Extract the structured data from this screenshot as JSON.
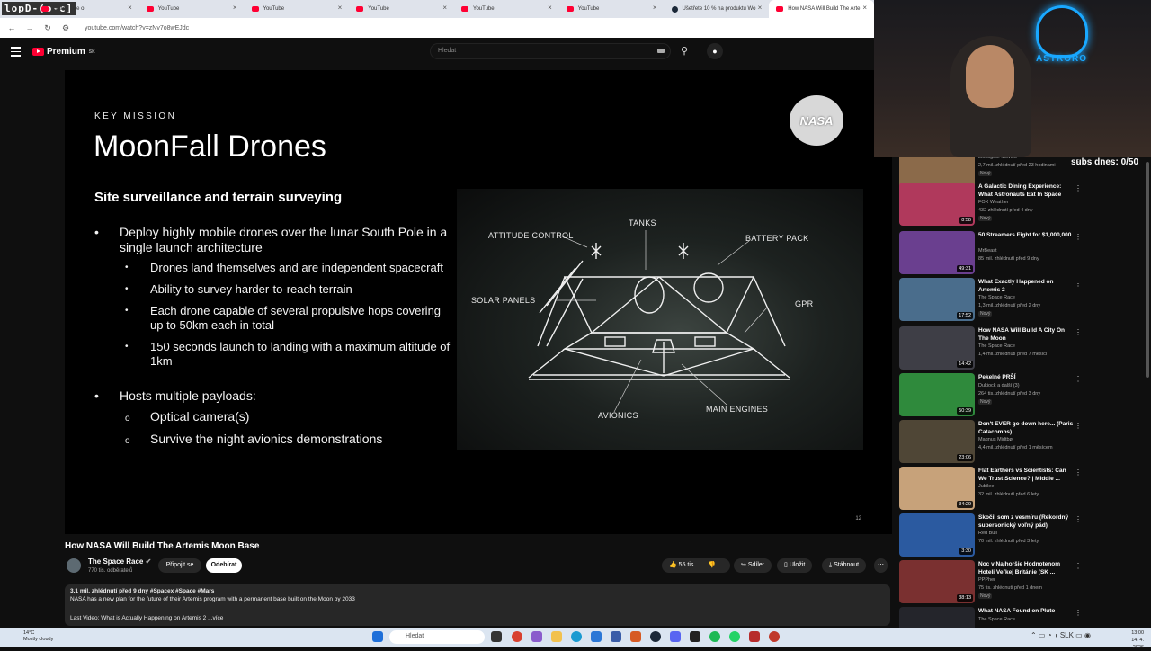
{
  "browser": {
    "stream_logo": "lopD-(o-c]",
    "tabs": [
      {
        "title": "Watch Live o",
        "icon": "youtube-icon"
      },
      {
        "title": "YouTube",
        "icon": "youtube-icon"
      },
      {
        "title": "YouTube",
        "icon": "youtube-icon"
      },
      {
        "title": "YouTube",
        "icon": "youtube-icon"
      },
      {
        "title": "YouTube",
        "icon": "youtube-icon"
      },
      {
        "title": "YouTube",
        "icon": "youtube-icon"
      },
      {
        "title": "Ušetřete 10 % na produktu Wo",
        "icon": "steam-icon"
      },
      {
        "title": "How NASA Will Build The Arte",
        "icon": "youtube-icon",
        "active": true
      }
    ],
    "url": "youtube.com/watch?v=zNv7o8wEJdc"
  },
  "youtube": {
    "logo_text": "Premium",
    "logo_sup": "SK",
    "search_placeholder": "Hledat"
  },
  "slide": {
    "kicker": "KEY MISSION",
    "title": "MoonFall Drones",
    "subtitle": "Site surveillance and terrain surveying",
    "b1_text": "Deploy highly mobile drones over the lunar South Pole in a single launch architecture",
    "b1_subs": [
      "Drones land themselves and are independent spacecraft",
      "Ability to survey harder-to-reach terrain",
      "Each drone capable of several propulsive hops covering up to 50km each in total",
      "150 seconds launch to landing with a maximum altitude of 1km"
    ],
    "b2_text": "Hosts multiple payloads:",
    "b2_subs": [
      "Optical camera(s)",
      "Survive the night avionics demonstrations"
    ],
    "nasa_logo": "NASA",
    "diagram_labels": {
      "tanks": "TANKS",
      "attitude": "ATTITUDE CONTROL",
      "battery": "BATTERY PACK",
      "solar": "SOLAR PANELS",
      "gpr": "GPR",
      "avionics": "AVIONICS",
      "engines": "MAIN ENGINES"
    },
    "slide_number": "12"
  },
  "video": {
    "title": "How NASA Will Build The Artemis Moon Base",
    "channel": "The Space Race",
    "subs": "770 tis. odběratelů",
    "join": "Připojit se",
    "subscribe": "Odebírat",
    "likes": "55 tis.",
    "share": "Sdílet",
    "save": "Uložit",
    "download": "Stáhnout",
    "desc_meta": "3,1 mil. zhlédnutí  před 9 dny  #Spacex #Space #Mars",
    "desc_line": "NASA has a new plan for the future of their Artemis program with a permanent base built on the Moon by 2033",
    "desc_last": "Last Video: What is Actually Happening on Artemis 2  ...více"
  },
  "stream_overlay": {
    "neon_text": "ASTRORO",
    "subs_counter": "subs dnes: 0/50"
  },
  "recommendations": [
    {
      "title": "",
      "channel": "Lionsgate Movies",
      "meta": "2,7 mil. zhlédnutí  před 23 hodinami",
      "badge": "Nový",
      "duration": "2:25",
      "color": "#8b6a4a"
    },
    {
      "title": "A Galactic Dining Experience: What Astronauts Eat In Space",
      "channel": "FOX Weather",
      "meta": "432 zhlédnutí  před 4 dny",
      "badge": "Nový",
      "duration": "8:58",
      "color": "#b0395c"
    },
    {
      "title": "50 Streamers Fight for $1,000,000",
      "channel": "MrBeast",
      "meta": "85 mil. zhlédnutí  před 9 dny",
      "badge": "",
      "duration": "49:31",
      "color": "#6a3f8f"
    },
    {
      "title": "What Exactly Happened on Artemis 2",
      "channel": "The Space Race",
      "meta": "1,3 mil. zhlédnutí  před 2 dny",
      "badge": "Nový",
      "duration": "17:52",
      "color": "#4a6d8c"
    },
    {
      "title": "How NASA Will Build A City On The Moon",
      "channel": "The Space Race",
      "meta": "1,4 mil. zhlédnutí  před 7 měsíci",
      "badge": "",
      "duration": "14:42",
      "color": "#3e3e46"
    },
    {
      "title": "Pekelné PRŠÍ",
      "channel": "Dukiock  a další (3)",
      "meta": "264 tis. zhlédnutí  před 3 dny",
      "badge": "Nový",
      "duration": "50:39",
      "color": "#2f8a3c"
    },
    {
      "title": "Don't EVER go down here... (Paris Catacombs)",
      "channel": "Magnus Midtbø",
      "meta": "4,4 mil. zhlédnutí  před 1 měsícem",
      "badge": "",
      "duration": "23:06",
      "color": "#4f4636"
    },
    {
      "title": "Flat Earthers vs Scientists: Can We Trust Science? | Middle ...",
      "channel": "Jubilee",
      "meta": "32 mil. zhlédnutí  před 6 lety",
      "badge": "",
      "duration": "34:29",
      "color": "#c7a27a"
    },
    {
      "title": "Skočil som z vesmíru (Rekordný supersonický voľný pád)",
      "channel": "Red Bull",
      "meta": "70 mil. zhlédnutí  před 3 lety",
      "badge": "",
      "duration": "3:30",
      "color": "#2b5aa0"
    },
    {
      "title": "Noc v Najhoršie Hodnotenom Hoteli Veľkej Británie (SK ...",
      "channel": "PPPher",
      "meta": "75 tis. zhlédnutí  před 1 dnem",
      "badge": "Nový",
      "duration": "38:13",
      "color": "#7a3030"
    },
    {
      "title": "What NASA Found on Pluto",
      "channel": "The Space Race",
      "meta": "",
      "badge": "",
      "duration": "",
      "color": "#24252b"
    }
  ],
  "taskbar": {
    "temp": "14°C",
    "weather": "Mostly cloudy",
    "search": "Hledat",
    "lang": "SLK",
    "time": "13:00",
    "date": "14. 4. 2026"
  }
}
